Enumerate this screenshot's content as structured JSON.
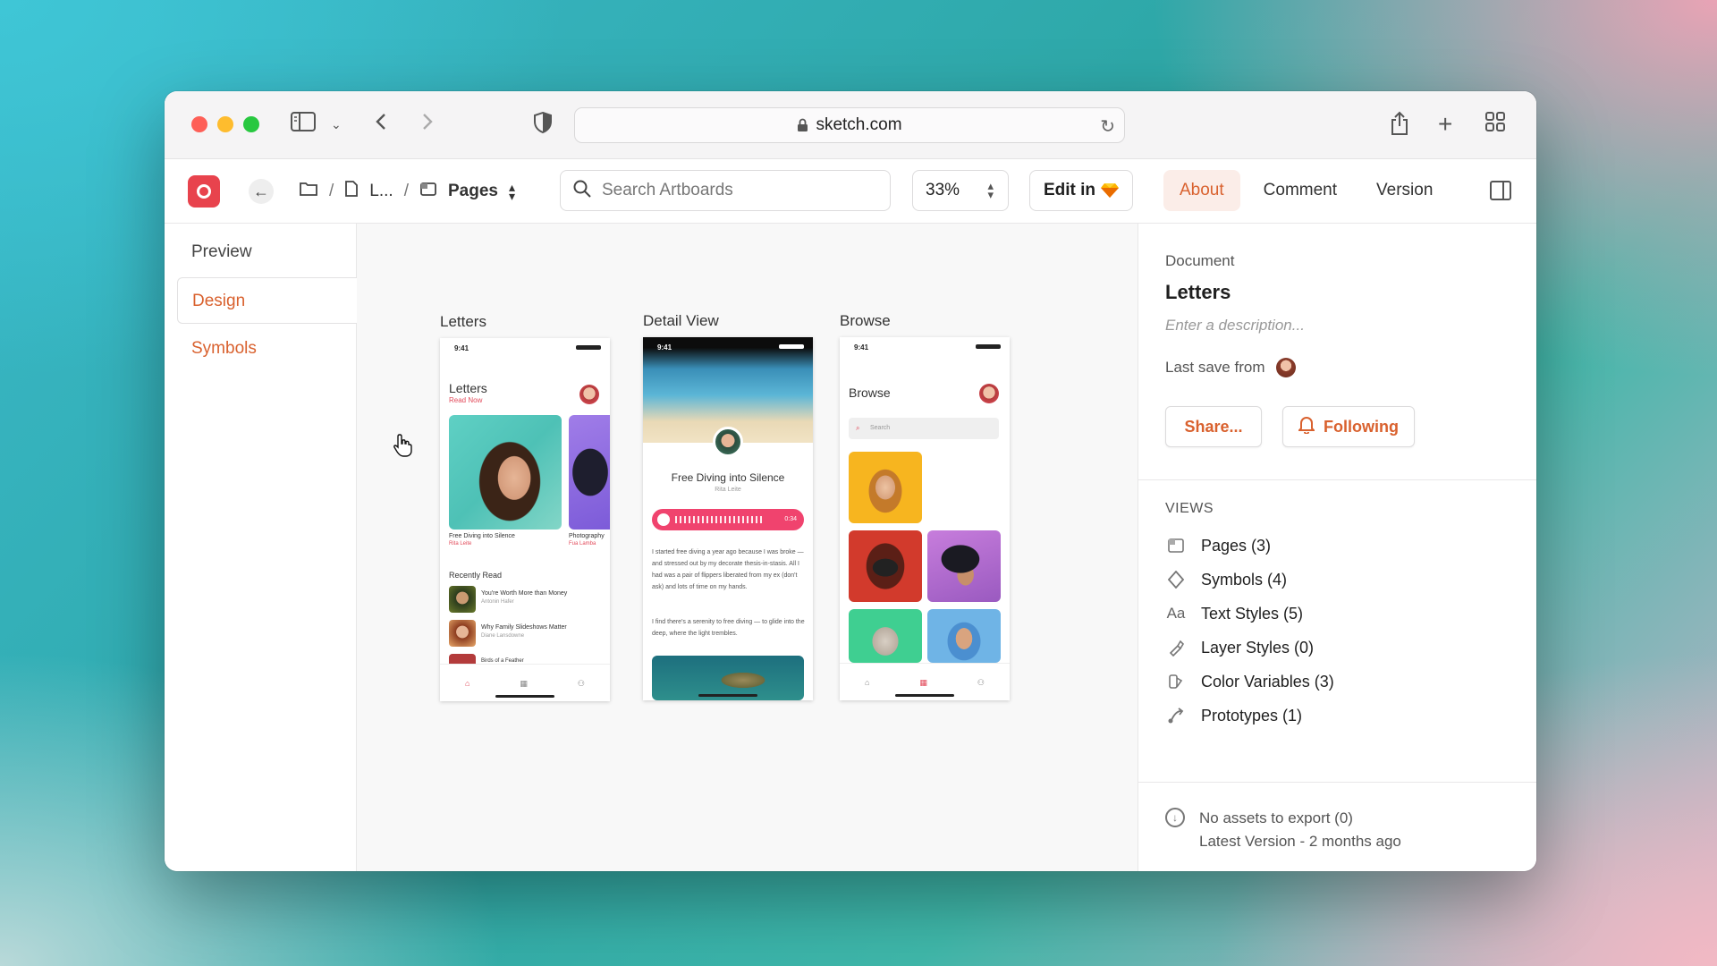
{
  "browser": {
    "url": "sketch.com"
  },
  "toolbar": {
    "breadcrumb_doc": "L...",
    "breadcrumb_sep": "/",
    "pages_label": "Pages",
    "search_placeholder": "Search Artboards",
    "zoom": "33%",
    "edit_in_label": "Edit in"
  },
  "tabs": [
    {
      "label": "About",
      "active": true
    },
    {
      "label": "Comment",
      "active": false
    },
    {
      "label": "Version",
      "active": false
    }
  ],
  "leftnav": {
    "items": [
      {
        "label": "Preview"
      },
      {
        "label": "Design"
      },
      {
        "label": "Symbols"
      }
    ]
  },
  "canvas": {
    "artboards": [
      {
        "label": "Letters",
        "time": "9:41",
        "title": "Letters",
        "subtitle": "Read Now",
        "card1_title": "Free Diving into Silence",
        "card1_author": "Rita Leite",
        "card2_title": "Photography",
        "card2_author": "Fua Lamba",
        "recent_label": "Recently Read",
        "recent": [
          {
            "title": "You're Worth More than Money",
            "author": "Antonin Hafer"
          },
          {
            "title": "Why Family Slideshows Matter",
            "author": "Diane Lansdowne"
          },
          {
            "title": "Birds of a Feather",
            "author": ""
          }
        ]
      },
      {
        "label": "Detail View",
        "time": "9:41",
        "title": "Free Diving into Silence",
        "author": "Rita Leite",
        "audio_time": "0:34",
        "para1": "I started free diving a year ago because I was broke — and stressed out by my decorate thesis-in-stasis. All I had was a pair of flippers liberated from my ex (don't ask) and lots of time on my hands.",
        "para2": "I find there's a serenity to free diving — to glide into the deep, where the light trembles."
      },
      {
        "label": "Browse",
        "time": "9:41",
        "title": "Browse",
        "search": "Search"
      }
    ]
  },
  "about": {
    "document_label": "Document",
    "document_title": "Letters",
    "description_placeholder": "Enter a description...",
    "last_save": "Last save from",
    "share_label": "Share...",
    "following_label": "Following",
    "views_heading": "VIEWS",
    "views": [
      {
        "icon": "pages-icon",
        "label": "Pages (3)"
      },
      {
        "icon": "symbol-diamond-icon",
        "label": "Symbols (4)"
      },
      {
        "icon": "text-styles-icon",
        "label": "Text Styles (5)"
      },
      {
        "icon": "layer-styles-icon",
        "label": "Layer Styles (0)"
      },
      {
        "icon": "color-variables-icon",
        "label": "Color Variables (3)"
      },
      {
        "icon": "prototype-icon",
        "label": "Prototypes (1)"
      }
    ],
    "export_line1": "No assets to export (0)",
    "export_line2": "Latest Version - 2 months ago"
  },
  "colors": {
    "accent": "#d9612e",
    "brand": "#e8434d",
    "traffic_red": "#fe5f57",
    "traffic_yellow": "#febc2e",
    "traffic_green": "#28c840"
  }
}
